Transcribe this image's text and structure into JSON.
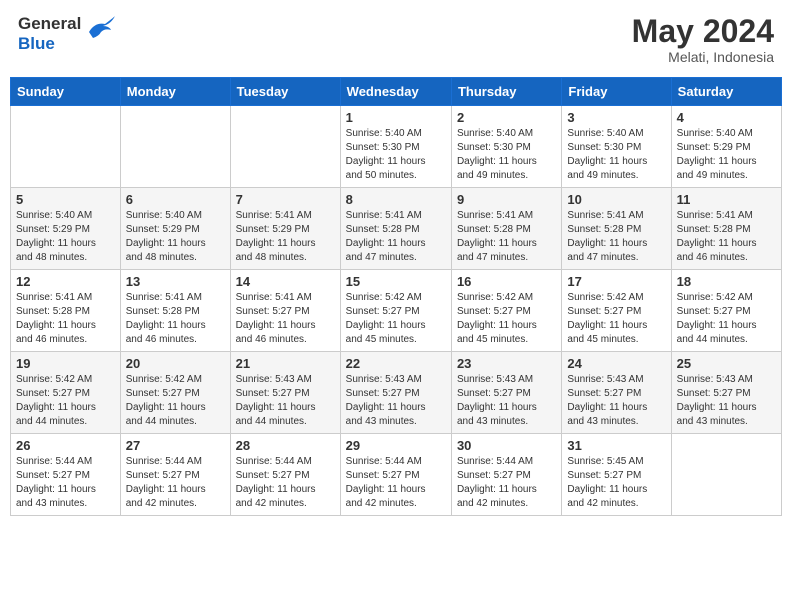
{
  "header": {
    "logo_line1": "General",
    "logo_line2": "Blue",
    "month_year": "May 2024",
    "location": "Melati, Indonesia"
  },
  "calendar": {
    "headers": [
      "Sunday",
      "Monday",
      "Tuesday",
      "Wednesday",
      "Thursday",
      "Friday",
      "Saturday"
    ],
    "weeks": [
      {
        "days": [
          {
            "num": "",
            "info": ""
          },
          {
            "num": "",
            "info": ""
          },
          {
            "num": "",
            "info": ""
          },
          {
            "num": "1",
            "info": "Sunrise: 5:40 AM\nSunset: 5:30 PM\nDaylight: 11 hours\nand 50 minutes."
          },
          {
            "num": "2",
            "info": "Sunrise: 5:40 AM\nSunset: 5:30 PM\nDaylight: 11 hours\nand 49 minutes."
          },
          {
            "num": "3",
            "info": "Sunrise: 5:40 AM\nSunset: 5:30 PM\nDaylight: 11 hours\nand 49 minutes."
          },
          {
            "num": "4",
            "info": "Sunrise: 5:40 AM\nSunset: 5:29 PM\nDaylight: 11 hours\nand 49 minutes."
          }
        ]
      },
      {
        "days": [
          {
            "num": "5",
            "info": "Sunrise: 5:40 AM\nSunset: 5:29 PM\nDaylight: 11 hours\nand 48 minutes."
          },
          {
            "num": "6",
            "info": "Sunrise: 5:40 AM\nSunset: 5:29 PM\nDaylight: 11 hours\nand 48 minutes."
          },
          {
            "num": "7",
            "info": "Sunrise: 5:41 AM\nSunset: 5:29 PM\nDaylight: 11 hours\nand 48 minutes."
          },
          {
            "num": "8",
            "info": "Sunrise: 5:41 AM\nSunset: 5:28 PM\nDaylight: 11 hours\nand 47 minutes."
          },
          {
            "num": "9",
            "info": "Sunrise: 5:41 AM\nSunset: 5:28 PM\nDaylight: 11 hours\nand 47 minutes."
          },
          {
            "num": "10",
            "info": "Sunrise: 5:41 AM\nSunset: 5:28 PM\nDaylight: 11 hours\nand 47 minutes."
          },
          {
            "num": "11",
            "info": "Sunrise: 5:41 AM\nSunset: 5:28 PM\nDaylight: 11 hours\nand 46 minutes."
          }
        ]
      },
      {
        "days": [
          {
            "num": "12",
            "info": "Sunrise: 5:41 AM\nSunset: 5:28 PM\nDaylight: 11 hours\nand 46 minutes."
          },
          {
            "num": "13",
            "info": "Sunrise: 5:41 AM\nSunset: 5:28 PM\nDaylight: 11 hours\nand 46 minutes."
          },
          {
            "num": "14",
            "info": "Sunrise: 5:41 AM\nSunset: 5:27 PM\nDaylight: 11 hours\nand 46 minutes."
          },
          {
            "num": "15",
            "info": "Sunrise: 5:42 AM\nSunset: 5:27 PM\nDaylight: 11 hours\nand 45 minutes."
          },
          {
            "num": "16",
            "info": "Sunrise: 5:42 AM\nSunset: 5:27 PM\nDaylight: 11 hours\nand 45 minutes."
          },
          {
            "num": "17",
            "info": "Sunrise: 5:42 AM\nSunset: 5:27 PM\nDaylight: 11 hours\nand 45 minutes."
          },
          {
            "num": "18",
            "info": "Sunrise: 5:42 AM\nSunset: 5:27 PM\nDaylight: 11 hours\nand 44 minutes."
          }
        ]
      },
      {
        "days": [
          {
            "num": "19",
            "info": "Sunrise: 5:42 AM\nSunset: 5:27 PM\nDaylight: 11 hours\nand 44 minutes."
          },
          {
            "num": "20",
            "info": "Sunrise: 5:42 AM\nSunset: 5:27 PM\nDaylight: 11 hours\nand 44 minutes."
          },
          {
            "num": "21",
            "info": "Sunrise: 5:43 AM\nSunset: 5:27 PM\nDaylight: 11 hours\nand 44 minutes."
          },
          {
            "num": "22",
            "info": "Sunrise: 5:43 AM\nSunset: 5:27 PM\nDaylight: 11 hours\nand 43 minutes."
          },
          {
            "num": "23",
            "info": "Sunrise: 5:43 AM\nSunset: 5:27 PM\nDaylight: 11 hours\nand 43 minutes."
          },
          {
            "num": "24",
            "info": "Sunrise: 5:43 AM\nSunset: 5:27 PM\nDaylight: 11 hours\nand 43 minutes."
          },
          {
            "num": "25",
            "info": "Sunrise: 5:43 AM\nSunset: 5:27 PM\nDaylight: 11 hours\nand 43 minutes."
          }
        ]
      },
      {
        "days": [
          {
            "num": "26",
            "info": "Sunrise: 5:44 AM\nSunset: 5:27 PM\nDaylight: 11 hours\nand 43 minutes."
          },
          {
            "num": "27",
            "info": "Sunrise: 5:44 AM\nSunset: 5:27 PM\nDaylight: 11 hours\nand 42 minutes."
          },
          {
            "num": "28",
            "info": "Sunrise: 5:44 AM\nSunset: 5:27 PM\nDaylight: 11 hours\nand 42 minutes."
          },
          {
            "num": "29",
            "info": "Sunrise: 5:44 AM\nSunset: 5:27 PM\nDaylight: 11 hours\nand 42 minutes."
          },
          {
            "num": "30",
            "info": "Sunrise: 5:44 AM\nSunset: 5:27 PM\nDaylight: 11 hours\nand 42 minutes."
          },
          {
            "num": "31",
            "info": "Sunrise: 5:45 AM\nSunset: 5:27 PM\nDaylight: 11 hours\nand 42 minutes."
          },
          {
            "num": "",
            "info": ""
          }
        ]
      }
    ]
  }
}
